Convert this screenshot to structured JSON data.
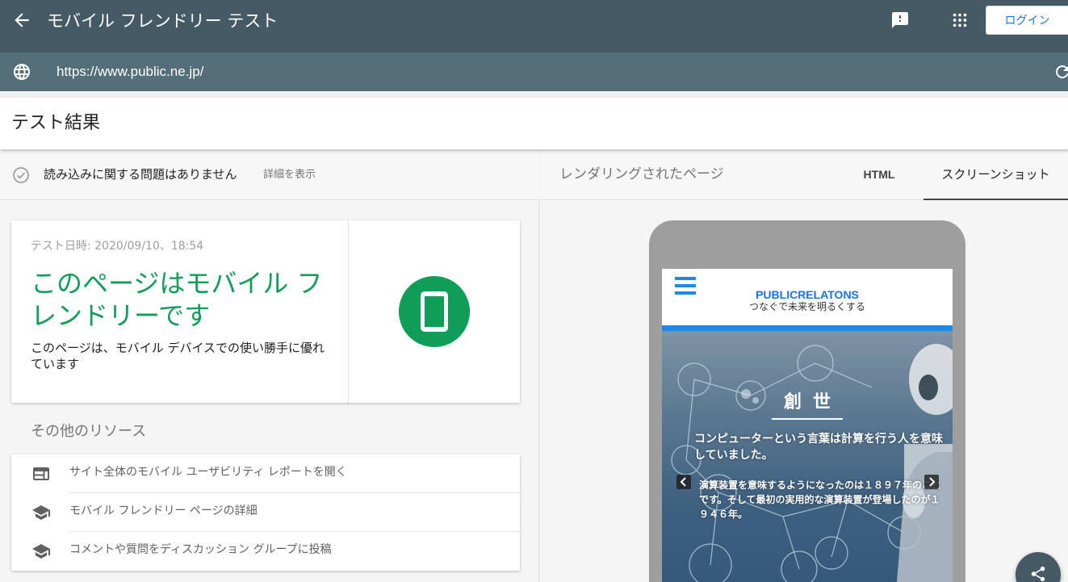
{
  "topbar": {
    "title": "モバイル フレンドリー テスト",
    "login_label": "ログイン"
  },
  "urlbar": {
    "url": "https://www.public.ne.jp/"
  },
  "results": {
    "title": "テスト結果"
  },
  "status": {
    "text": "読み込みに関する問題はありません",
    "details_link": "詳細を表示"
  },
  "result_card": {
    "test_date": "テスト日時: 2020/09/10、18:54",
    "verdict": "このページはモバイル フレンドリーです",
    "description": "このページは、モバイル デバイスでの使い勝手に優れています",
    "accent_color": "#0f9d58"
  },
  "resources": {
    "title": "その他のリソース",
    "items": [
      {
        "label": "サイト全体のモバイル ユーザビリティ レポートを開く",
        "icon": "web-report-icon"
      },
      {
        "label": "モバイル フレンドリー ページの詳細",
        "icon": "school-icon"
      },
      {
        "label": "コメントや質問をディスカッション グループに投稿",
        "icon": "school-icon"
      }
    ]
  },
  "right_panel": {
    "rendered_label": "レンダリングされたページ",
    "tabs": [
      {
        "label": "HTML",
        "active": false
      },
      {
        "label": "スクリーンショット",
        "active": true
      }
    ]
  },
  "site_preview": {
    "brand": "PUBLICRELATONS",
    "tagline": "つなぐで未来を明るくする",
    "hero_title": "創世",
    "hero_lead": "コンピューターという言葉は計算を行う人を意味していました。",
    "hero_body": "演算装置を意味するようになったのは１８９７年のことです。そして最初の実用的な演算装置が登場したのが１９４６年。",
    "brand_color": "#1e88e5"
  },
  "colors": {
    "topbar": "#455a64",
    "urlbar": "#546e7a"
  }
}
